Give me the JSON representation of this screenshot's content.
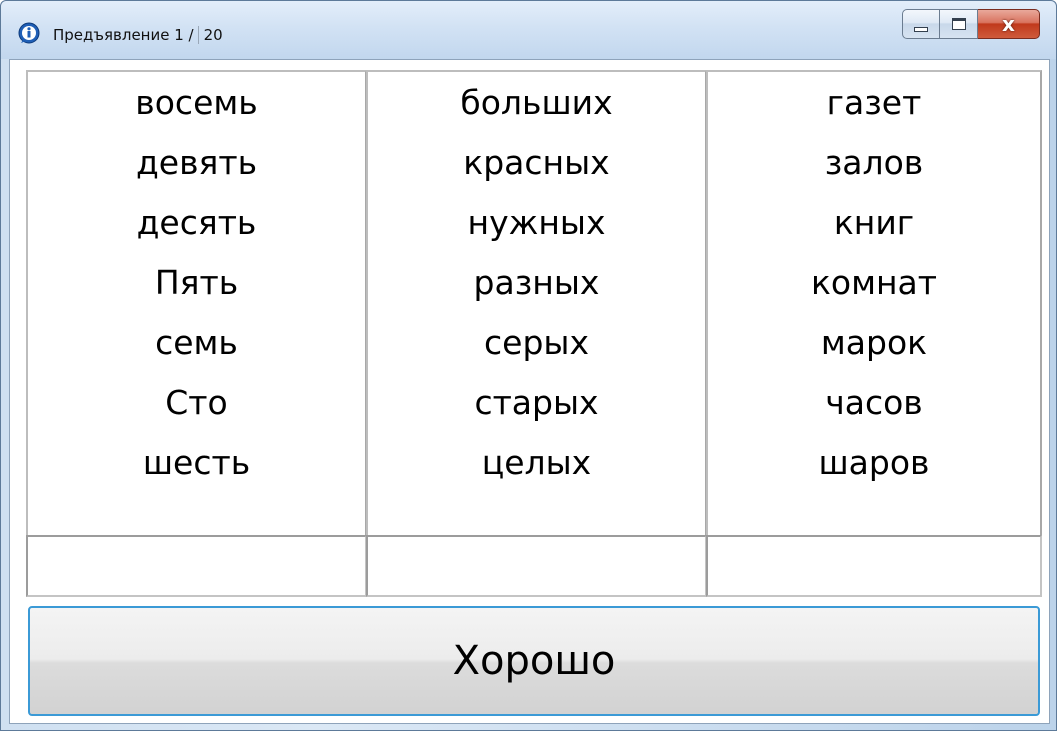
{
  "window": {
    "title_prefix": "Предъявление 1 /",
    "title_total": "20",
    "icon": "info-bubble-icon",
    "minimize_icon": "minimize-icon",
    "maximize_icon": "maximize-icon",
    "close_icon": "close-icon",
    "close_label": "x"
  },
  "columns": [
    {
      "words": [
        "восемь",
        "девять",
        "десять",
        "Пять",
        "семь",
        "Сто",
        "шесть"
      ]
    },
    {
      "words": [
        "больших",
        "красных",
        "нужных",
        "разных",
        "серых",
        "старых",
        "целых"
      ]
    },
    {
      "words": [
        "газет",
        "залов",
        "книг",
        "комнат",
        "марок",
        "часов",
        "шаров"
      ]
    }
  ],
  "answers": [
    "",
    "",
    ""
  ],
  "ok_button": {
    "label": "Хорошо"
  },
  "colors": {
    "button_focus_border": "#3b9ad6",
    "close_button": "#c0391c",
    "titlebar": "#d2e2f4"
  }
}
